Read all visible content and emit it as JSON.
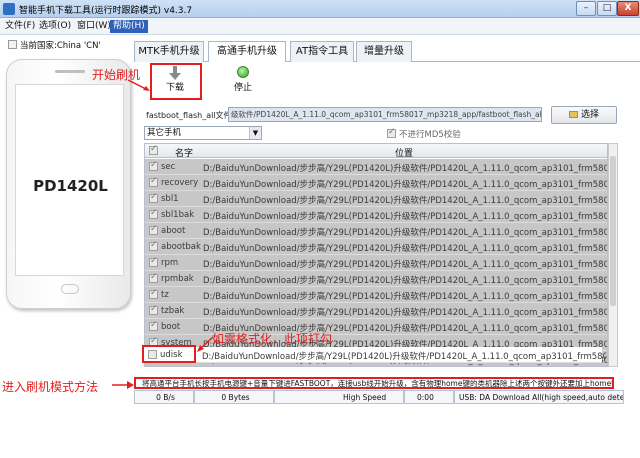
{
  "window": {
    "title": "智能手机下载工具(运行时跟踪模式)  v4.3.7",
    "min": "–",
    "max": "□",
    "close": "X"
  },
  "menu": [
    {
      "label": "文件(F)"
    },
    {
      "label": "选项(O)"
    },
    {
      "label": "窗口(W)"
    },
    {
      "label": "帮助(H)"
    }
  ],
  "left": {
    "country": "当前国家:China 'CN'",
    "phone_model": "PD1420L"
  },
  "tabs": [
    {
      "label": "MTK手机升级"
    },
    {
      "label": "高通手机升级"
    },
    {
      "label": "AT指令工具"
    },
    {
      "label": "增量升级"
    }
  ],
  "toolbar": {
    "download_label": "下载",
    "stop_label": "停止"
  },
  "file": {
    "label": "fastboot_flash_all文件",
    "path": "级软件/PD1420L_A_1.11.0_qcom_ap3101_frm58017_mp3218_app/fastboot_flash_all.bat",
    "pick_button": "选择"
  },
  "phone_select": {
    "value": "其它手机"
  },
  "md5_label": "不进行MD5校验",
  "table": {
    "headers": [
      "名字",
      "位置"
    ],
    "rows": [
      {
        "name": "sec",
        "path": "D:/BaiduYunDownload/步步高/Y29L(PD1420L)升级软件/PD1420L_A_1.11.0_qcom_ap3101_frm58017_mp3218_a..."
      },
      {
        "name": "recovery",
        "path": "D:/BaiduYunDownload/步步高/Y29L(PD1420L)升级软件/PD1420L_A_1.11.0_qcom_ap3101_frm58017_mp3218_a..."
      },
      {
        "name": "sbl1",
        "path": "D:/BaiduYunDownload/步步高/Y29L(PD1420L)升级软件/PD1420L_A_1.11.0_qcom_ap3101_frm58017_mp3218_a..."
      },
      {
        "name": "sbl1bak",
        "path": "D:/BaiduYunDownload/步步高/Y29L(PD1420L)升级软件/PD1420L_A_1.11.0_qcom_ap3101_frm58017_mp3218_a..."
      },
      {
        "name": "aboot",
        "path": "D:/BaiduYunDownload/步步高/Y29L(PD1420L)升级软件/PD1420L_A_1.11.0_qcom_ap3101_frm58017_mp3218_a..."
      },
      {
        "name": "abootbak",
        "path": "D:/BaiduYunDownload/步步高/Y29L(PD1420L)升级软件/PD1420L_A_1.11.0_qcom_ap3101_frm58017_mp3218_a..."
      },
      {
        "name": "rpm",
        "path": "D:/BaiduYunDownload/步步高/Y29L(PD1420L)升级软件/PD1420L_A_1.11.0_qcom_ap3101_frm58017_mp3218_a..."
      },
      {
        "name": "rpmbak",
        "path": "D:/BaiduYunDownload/步步高/Y29L(PD1420L)升级软件/PD1420L_A_1.11.0_qcom_ap3101_frm58017_mp3218_a..."
      },
      {
        "name": "tz",
        "path": "D:/BaiduYunDownload/步步高/Y29L(PD1420L)升级软件/PD1420L_A_1.11.0_qcom_ap3101_frm58017_mp3218_a..."
      },
      {
        "name": "tzbak",
        "path": "D:/BaiduYunDownload/步步高/Y29L(PD1420L)升级软件/PD1420L_A_1.11.0_qcom_ap3101_frm58017_mp3218_a..."
      },
      {
        "name": "boot",
        "path": "D:/BaiduYunDownload/步步高/Y29L(PD1420L)升级软件/PD1420L_A_1.11.0_qcom_ap3101_frm58017_mp3218_a..."
      },
      {
        "name": "system",
        "path": "D:/BaiduYunDownload/步步高/Y29L(PD1420L)升级软件/PD1420L_A_1.11.0_qcom_ap3101_frm58017_mp3218_a..."
      },
      {
        "name": "userdata",
        "path": "D:/BaiduYunDownload/步步高/Y29L(PD1420L)升级软件/PD1420L_A_1.11.0_qcom_ap3101_frm58017_mp3218_a..."
      },
      {
        "name": "udisk",
        "path": "D:/BaiduYunDownload/步步高/Y29L(PD1420L)升级软件/PD1420L_A_1.11.0_qcom_ap3101_frm58017_mp3218_a..."
      }
    ]
  },
  "annotations": {
    "start_flash": "开始刷机",
    "format_note": "如需格式化，此项打勾",
    "enter_mode": "进入刷机模式方法"
  },
  "tip": "将高通平台手机长按手机电源键+音量下键进FASTBOOT，连接usb线开始升级，含有物理home键的类机器除上述两个按键外还要加上home键 0%",
  "status": {
    "speed": "0 B/s",
    "bytes": "0 Bytes",
    "mode": "High Speed",
    "time": "0:00",
    "usb": "USB: DA Download All(high speed,auto detect)"
  },
  "colors": {
    "annotation": "#e02020",
    "menu_active": "#2e62b8"
  }
}
